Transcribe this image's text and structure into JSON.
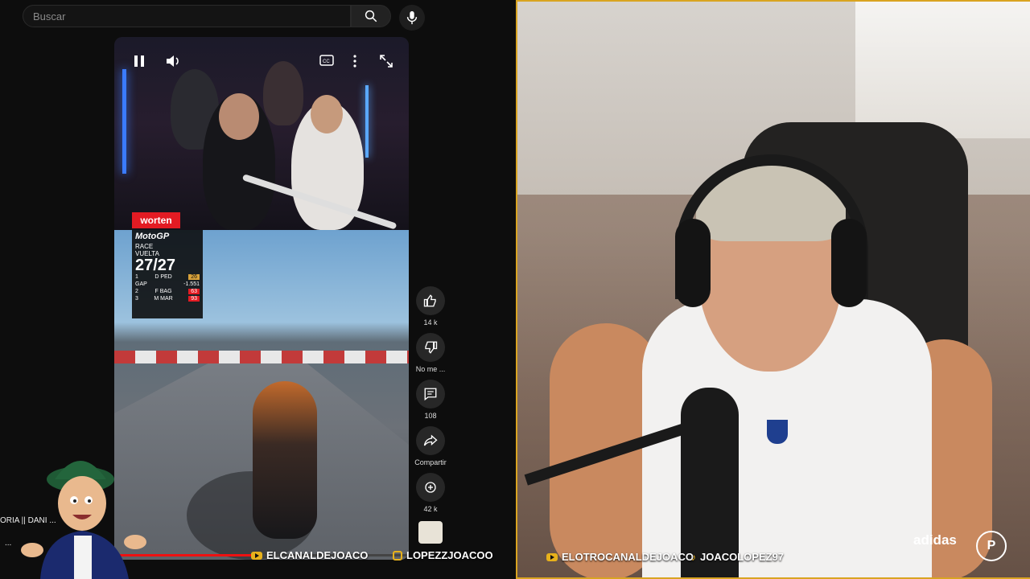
{
  "search": {
    "placeholder": "Buscar"
  },
  "short": {
    "overlay": {
      "sponsor": "worten",
      "series": "MotoGP",
      "race": "RACE",
      "lap_label": "VUELTA",
      "lap_value": "27/27",
      "leader": {
        "pos": "1",
        "name": "D PED",
        "num": "26"
      },
      "gap": {
        "label": "GAP",
        "value": "-1.551"
      },
      "rows": [
        {
          "pos": "2",
          "name": "F BAG",
          "num": "63"
        },
        {
          "pos": "3",
          "name": "M MAR",
          "num": "93"
        }
      ]
    },
    "progress": 0.5
  },
  "actions": [
    {
      "icon": "thumbs-up-icon",
      "label": "14 k"
    },
    {
      "icon": "thumbs-down-icon",
      "label": "No me ..."
    },
    {
      "icon": "comment-icon",
      "label": "108"
    },
    {
      "icon": "share-icon",
      "label": "Compartir"
    },
    {
      "icon": "remix-icon",
      "label": "42 k"
    }
  ],
  "sidebar": {
    "text": "ORIA || DANI ...",
    "dots": "..."
  },
  "left_social": [
    {
      "icon": "youtube-kick-icon",
      "text": "ELCANALDEJOACO"
    },
    {
      "icon": "instagram-icon",
      "text": "LOPEZZJOACOO"
    }
  ],
  "right_social": [
    {
      "icon": "youtube-icon",
      "text": "ELOTROCANALDEJOACO"
    },
    {
      "icon": "tiktok-icon",
      "text": "JOACOLOPEZ97"
    }
  ],
  "brand": "adidas",
  "colors": {
    "accent": "#d9a421",
    "red": "#e31b23"
  }
}
